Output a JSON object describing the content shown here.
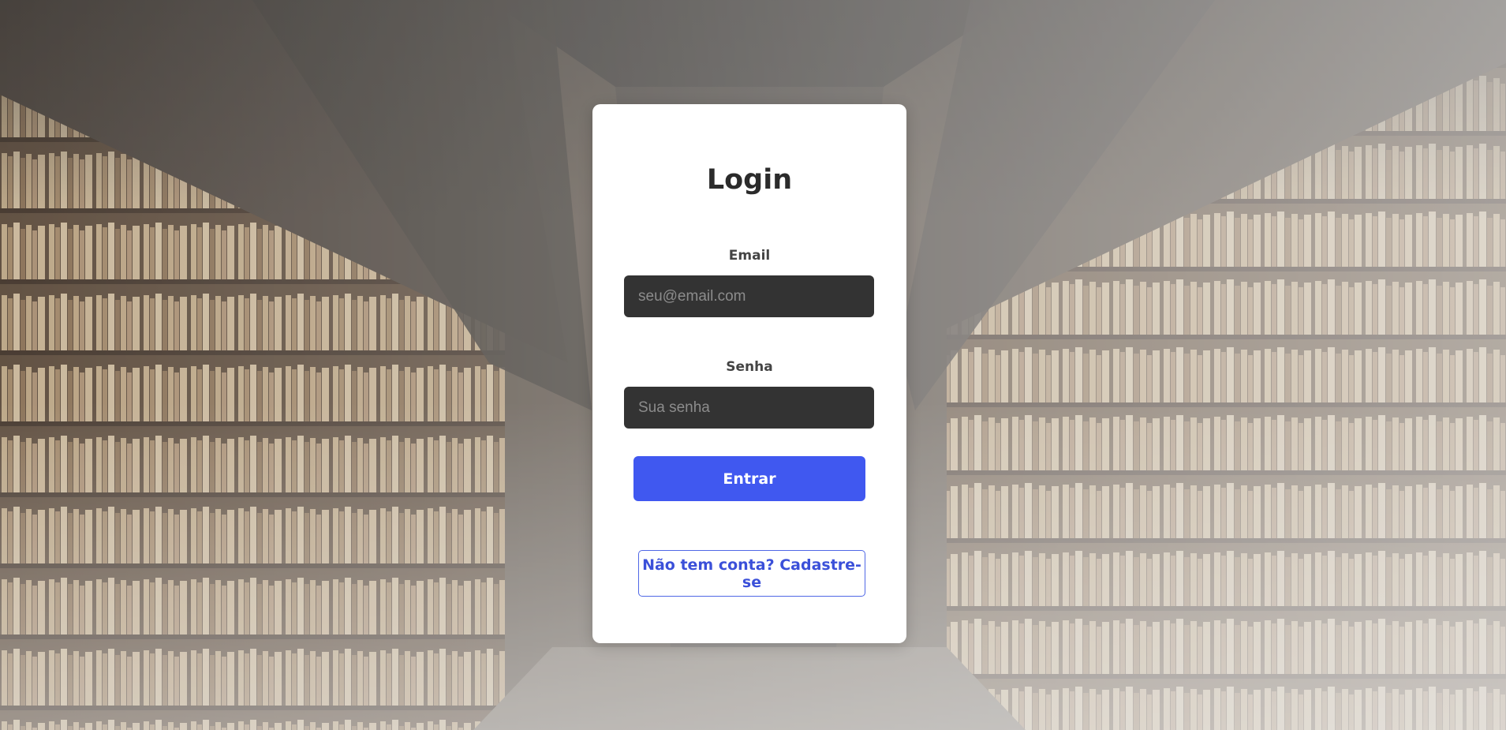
{
  "login": {
    "title": "Login",
    "email_label": "Email",
    "email_placeholder": "seu@email.com",
    "email_value": "",
    "password_label": "Senha",
    "password_placeholder": "Sua senha",
    "password_value": "",
    "submit_label": "Entrar",
    "signup_label": "Não tem conta? Cadastre-se"
  },
  "colors": {
    "primary": "#4058f0",
    "link": "#3b50d9",
    "input_bg": "#333333",
    "card_bg": "#ffffff"
  }
}
